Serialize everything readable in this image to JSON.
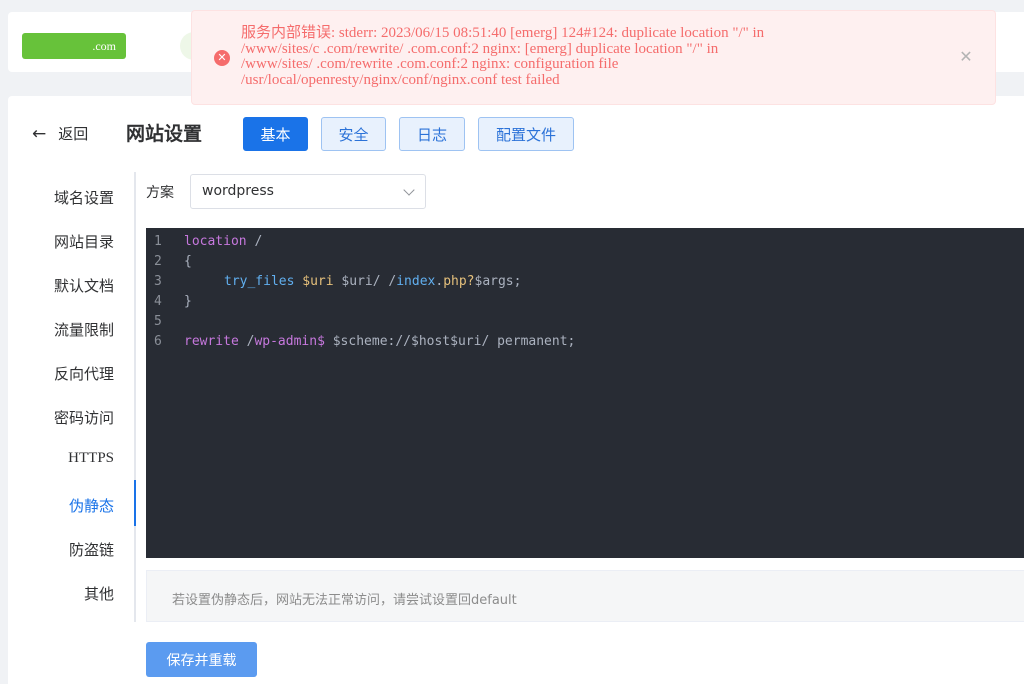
{
  "header": {
    "site_domain": ".com"
  },
  "error": {
    "lines": [
      "服务内部错误: stderr: 2023/06/15 08:51:40 [emerg] 124#124: duplicate location \"/\" in",
      "/www/sites/c                .com/rewrite/                .com.conf:2 nginx: [emerg] duplicate location \"/\" in",
      "/www/sites/                 .com/rewrite                 .com.conf:2 nginx: configuration file",
      "/usr/local/openresty/nginx/conf/nginx.conf test failed"
    ]
  },
  "nav": {
    "back_label": "返回",
    "title": "网站设置",
    "tabs": [
      {
        "label": "基本",
        "active": true
      },
      {
        "label": "安全",
        "active": false
      },
      {
        "label": "日志",
        "active": false
      },
      {
        "label": "配置文件",
        "active": false
      }
    ]
  },
  "side_menu": {
    "items": [
      "域名设置",
      "网站目录",
      "默认文档",
      "流量限制",
      "反向代理",
      "密码访问",
      "HTTPS",
      "伪静态",
      "防盗链",
      "其他"
    ],
    "active_index": 7
  },
  "scheme": {
    "label": "方案",
    "value": "wordpress"
  },
  "editor": {
    "line_numbers": [
      "1",
      "2",
      "3",
      "4",
      "5",
      "6"
    ],
    "tokens": {
      "l1_kw": "location",
      "l1_rest": " /",
      "l2": "{",
      "l3_fn": "try_files",
      "l3_var": "$uri",
      "l3_a": " $uri/ /",
      "l3_fn2": "index",
      "l3_b": ".",
      "l3_var2": "php?",
      "l3_c": "$args;",
      "l4": "}",
      "l6_kw": "rewrite",
      "l6_a": " /",
      "l6_kw2": "wp-admin$",
      "l6_b": " $scheme://$host$uri/ permanent;"
    }
  },
  "hint": {
    "text": "若设置伪静态后，网站无法正常访问，请尝试设置回default"
  },
  "actions": {
    "save_label": "保存并重载"
  },
  "colors": {
    "primary": "#1a73e8",
    "error": "#f56c6c",
    "editor_bg": "#282c34"
  }
}
